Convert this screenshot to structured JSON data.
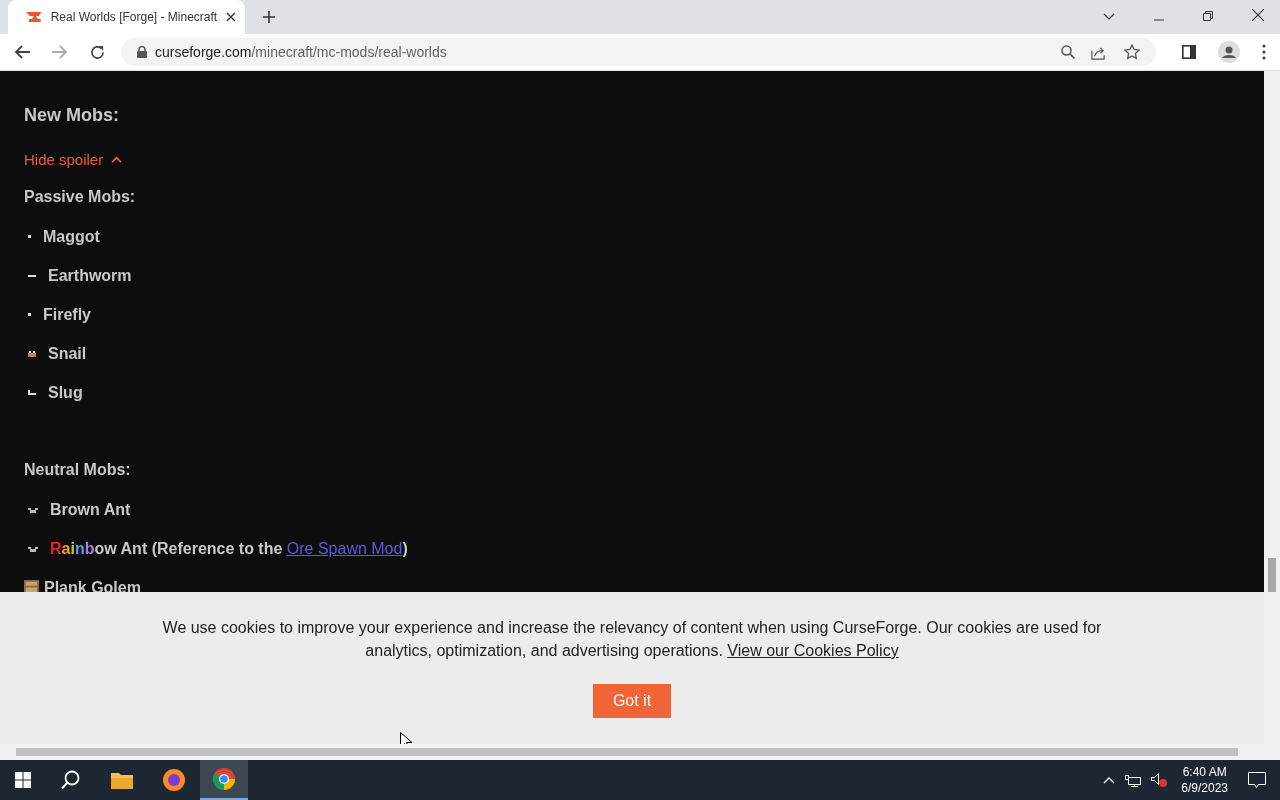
{
  "browser": {
    "tab_title": "Real Worlds [Forge] - Minecraft",
    "url_domain": "curseforge.com",
    "url_path": "/minecraft/mc-mods/real-worlds"
  },
  "content": {
    "heading": "New Mobs:",
    "spoiler_toggle": "Hide spoiler",
    "sections": [
      {
        "title": "Passive Mobs:",
        "mobs": [
          {
            "kind": "dot",
            "name": "Maggot"
          },
          {
            "kind": "dash",
            "name": "Earthworm"
          },
          {
            "kind": "dot",
            "name": "Firefly"
          },
          {
            "kind": "snail",
            "name": "Snail"
          },
          {
            "kind": "slug",
            "name": "Slug"
          }
        ]
      },
      {
        "title": "Neutral Mobs:",
        "mobs": [
          {
            "kind": "ant",
            "name": "Brown Ant"
          },
          {
            "kind": "ant",
            "rainbow": [
              {
                "text": "R",
                "color": "#e8261c"
              },
              {
                "text": "a",
                "color": "#f0a020"
              },
              {
                "text": "i",
                "color": "#c8c03a"
              },
              {
                "text": "n",
                "color": "#4fa0e0"
              },
              {
                "text": "b",
                "color": "#b07adc"
              }
            ],
            "name": "ow Ant (Reference to the ",
            "link": "Ore Spawn Mod",
            "after": ")"
          },
          {
            "kind": "crate",
            "name": "Plank Golem"
          }
        ]
      }
    ]
  },
  "cookie_banner": {
    "text": "We use cookies to improve your experience and increase the relevancy of content when using CurseForge. Our cookies are used for analytics, optimization, and advertising operations.",
    "link": "View our Cookies Policy",
    "button": "Got it"
  },
  "taskbar": {
    "time": "6:40 AM",
    "date": "6/9/2023"
  }
}
